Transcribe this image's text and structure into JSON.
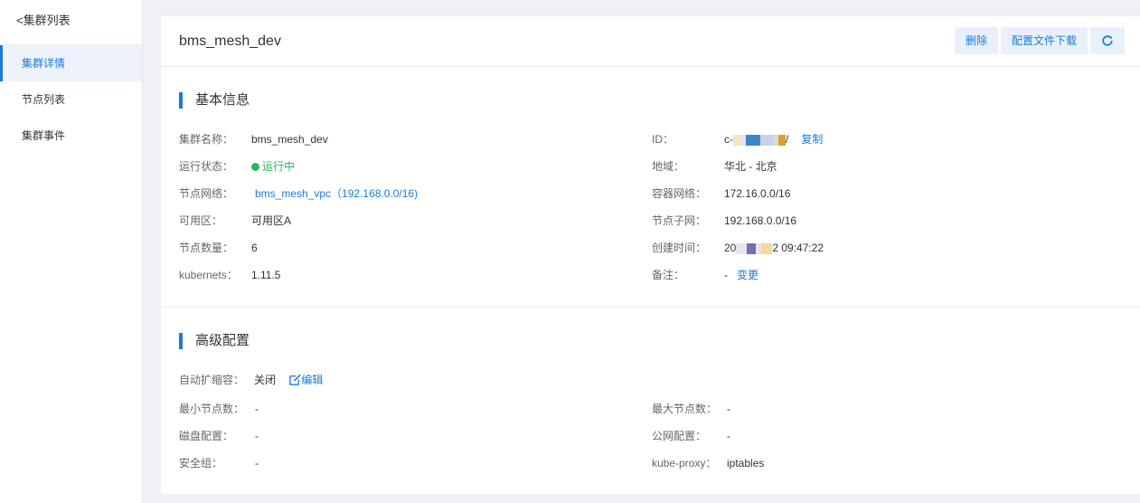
{
  "sidebar": {
    "back_label": "<集群列表",
    "items": [
      {
        "label": "集群详情"
      },
      {
        "label": "节点列表"
      },
      {
        "label": "集群事件"
      }
    ]
  },
  "header": {
    "title": "bms_mesh_dev",
    "delete_label": "删除",
    "download_label": "配置文件下载"
  },
  "basic": {
    "title": "基本信息",
    "cluster_name_label": "集群名称：",
    "cluster_name": "bms_mesh_dev",
    "status_label": "运行状态：",
    "status": "运行中",
    "network_label": "节点网络：",
    "network": "bms_mesh_vpc（192.168.0.0/16)",
    "zone_label": "可用区：",
    "zone": "可用区A",
    "node_count_label": "节点数量：",
    "node_count": "6",
    "k8s_label": "kubernets：",
    "k8s_version": "1.11.5",
    "id_label": "ID：",
    "id_prefix": "c-",
    "id_suffix": "/",
    "copy_label": "复制",
    "region_label": "地域：",
    "region": "华北 - 北京",
    "container_net_label": "容器网络：",
    "container_net": "172.16.0.0/16",
    "subnet_label": "节点子网：",
    "subnet": "192.168.0.0/16",
    "created_label": "创建时间：",
    "created_prefix": "20",
    "created_suffix": "2 09:47:22",
    "remark_label": "备注：",
    "remark": "-",
    "change_label": "变更"
  },
  "advanced": {
    "title": "高级配置",
    "autoscale_label": "自动扩缩容：",
    "autoscale": "关闭",
    "edit_label": "编辑",
    "min_nodes_label": "最小节点数：",
    "min_nodes": "-",
    "max_nodes_label": "最大节点数：",
    "max_nodes": "-",
    "disk_label": "磁盘配置：",
    "disk": "-",
    "public_label": "公网配置：",
    "public": "-",
    "sg_label": "安全组：",
    "sg": "-",
    "proxy_label": "kube-proxy：",
    "proxy": "iptables"
  },
  "colors": {
    "accent": "#1a7ad9",
    "running": "#2cb35a"
  }
}
